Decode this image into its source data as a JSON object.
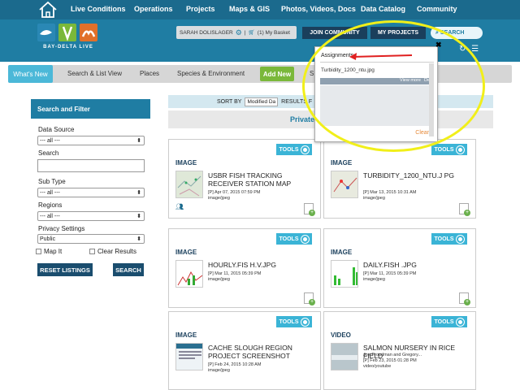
{
  "top_nav": {
    "items": [
      "Live Conditions",
      "Operations",
      "Projects",
      "Maps & GIS",
      "Photos, Videos, Docs",
      "Data Catalog",
      "Community"
    ]
  },
  "header": {
    "logo_text": "BAY-DELTA LIVE",
    "user_name": "SARAH DOLISLAGER",
    "basket": "(1) My Basket",
    "join_community": "JOIN COMMUNITY",
    "my_projects": "MY PROJECTS",
    "search_placeholder": "SEARCH"
  },
  "sub_nav": {
    "active": "What's New",
    "items": [
      "Search & List View",
      "Places",
      "Species & Environment"
    ],
    "add_new": "Add New",
    "partial": "S"
  },
  "sidebar": {
    "title": "Search and Filter",
    "data_source_label": "Data Source",
    "data_source_value": "--- all ---",
    "search_label": "Search",
    "search_value": "",
    "subtype_label": "Sub Type",
    "subtype_value": "--- all ---",
    "regions_label": "Regions",
    "regions_value": "--- all ---",
    "privacy_label": "Privacy Settings",
    "privacy_value": "Public",
    "map_it": "Map It",
    "clear_results": "Clear Results",
    "reset_button": "RESET LISTINGS",
    "search_button": "SEARCH"
  },
  "sort_bar": {
    "label": "SORT BY",
    "sort_value": "Modified Da",
    "results_label": "RESULTS F"
  },
  "privacy_bar": "Private",
  "cards": [
    {
      "tools": "TOOLS",
      "type": "IMAGE",
      "title": "USBR FISH TRACKING RECEIVER STATION MAP",
      "date": "[P] Apr 07, 2015 07:59 PM",
      "format": "image/jpeg"
    },
    {
      "tools": "TOOLS",
      "type": "IMAGE",
      "title": "TURBIDITY_1200_NTU.J PG",
      "date": "[P] Mar 13, 2015 10:31 AM",
      "format": "image/jpeg"
    },
    {
      "tools": "TOOLS",
      "type": "IMAGE",
      "title": "HOURLY.FIS H.V.JPG",
      "date": "[P] Mar 11, 2015 05:39 PM",
      "format": "image/jpeg"
    },
    {
      "tools": "TOOLS",
      "type": "IMAGE",
      "title": "DAILY.FISH .JPG",
      "date": "[P] Mar 11, 2015 05:39 PM",
      "format": "image/jpeg"
    },
    {
      "tools": "TOOLS",
      "type": "IMAGE",
      "title": "CACHE SLOUGH REGION PROJECT SCREENSHOT",
      "date": "[P] Feb 24, 2015 10:28 AM",
      "format": "image/jpeg"
    },
    {
      "tools": "TOOLS",
      "type": "VIDEO",
      "title": "SALMON NURSERY IN RICE FIELD",
      "author": "Joe Proudman and Gregory...",
      "date": "[P] Feb 23, 2015 01:28 PM",
      "format": "video/youtube"
    }
  ],
  "popup": {
    "title": "Assignments",
    "item": "Turbidity_1200_ntu.jpg",
    "view_more": "View more",
    "delete": "Delete",
    "clear": "Clear",
    "close": "✖"
  },
  "colors": {
    "brand_blue": "#1f7da3",
    "dark_blue": "#1a3f5c",
    "accent_cyan": "#3bb4d6",
    "green": "#7ab83a",
    "highlight": "#f1ef1a",
    "annotation_arrow": "#e02020"
  }
}
